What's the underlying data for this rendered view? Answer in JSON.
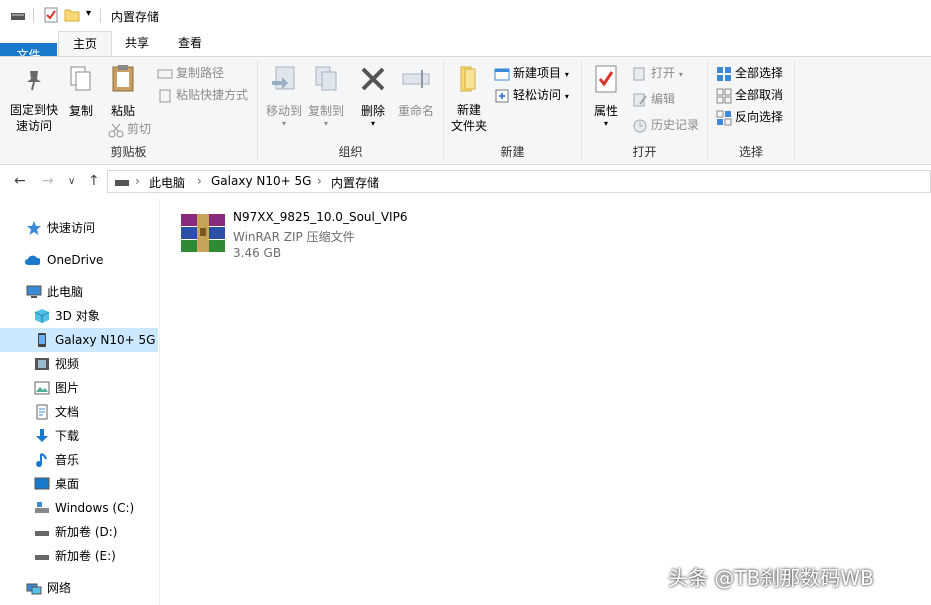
{
  "window": {
    "title": "内置存储"
  },
  "tabs": [
    {
      "label": "文件"
    },
    {
      "label": "主页"
    },
    {
      "label": "共享"
    },
    {
      "label": "查看"
    }
  ],
  "ribbon": {
    "clipboard": {
      "label": "剪贴板",
      "pin": "固定到快\n速访问",
      "copy": "复制",
      "paste": "粘贴",
      "copy_path": "复制路径",
      "paste_shortcut": "粘贴快捷方式",
      "cut": "剪切"
    },
    "organize": {
      "label": "组织",
      "move_to": "移动到",
      "copy_to": "复制到",
      "delete": "删除",
      "rename": "重命名"
    },
    "new": {
      "label": "新建",
      "new_folder": "新建\n文件夹",
      "new_item": "新建项目",
      "easy_access": "轻松访问"
    },
    "open": {
      "label": "打开",
      "properties": "属性",
      "open": "打开",
      "edit": "编辑",
      "history": "历史记录"
    },
    "select": {
      "label": "选择",
      "select_all": "全部选择",
      "select_none": "全部取消",
      "invert": "反向选择"
    }
  },
  "address": {
    "crumbs": [
      "此电脑",
      "Galaxy N10+ 5G",
      "内置存储"
    ]
  },
  "nav": {
    "quick_access": "快速访问",
    "onedrive": "OneDrive",
    "this_pc": "此电脑",
    "items": [
      "3D 对象",
      "Galaxy N10+ 5G",
      "视频",
      "图片",
      "文档",
      "下载",
      "音乐",
      "桌面",
      "Windows (C:)",
      "新加卷 (D:)",
      "新加卷 (E:)"
    ],
    "network": "网络"
  },
  "file": {
    "name": "N97XX_9825_10.0_Soul_VIP6",
    "type": "WinRAR ZIP 压缩文件",
    "size": "3.46 GB"
  },
  "watermark": "头条 @TB刹那数码WB",
  "colors": {
    "accent": "#1979ca",
    "selected": "#cce8ff"
  }
}
